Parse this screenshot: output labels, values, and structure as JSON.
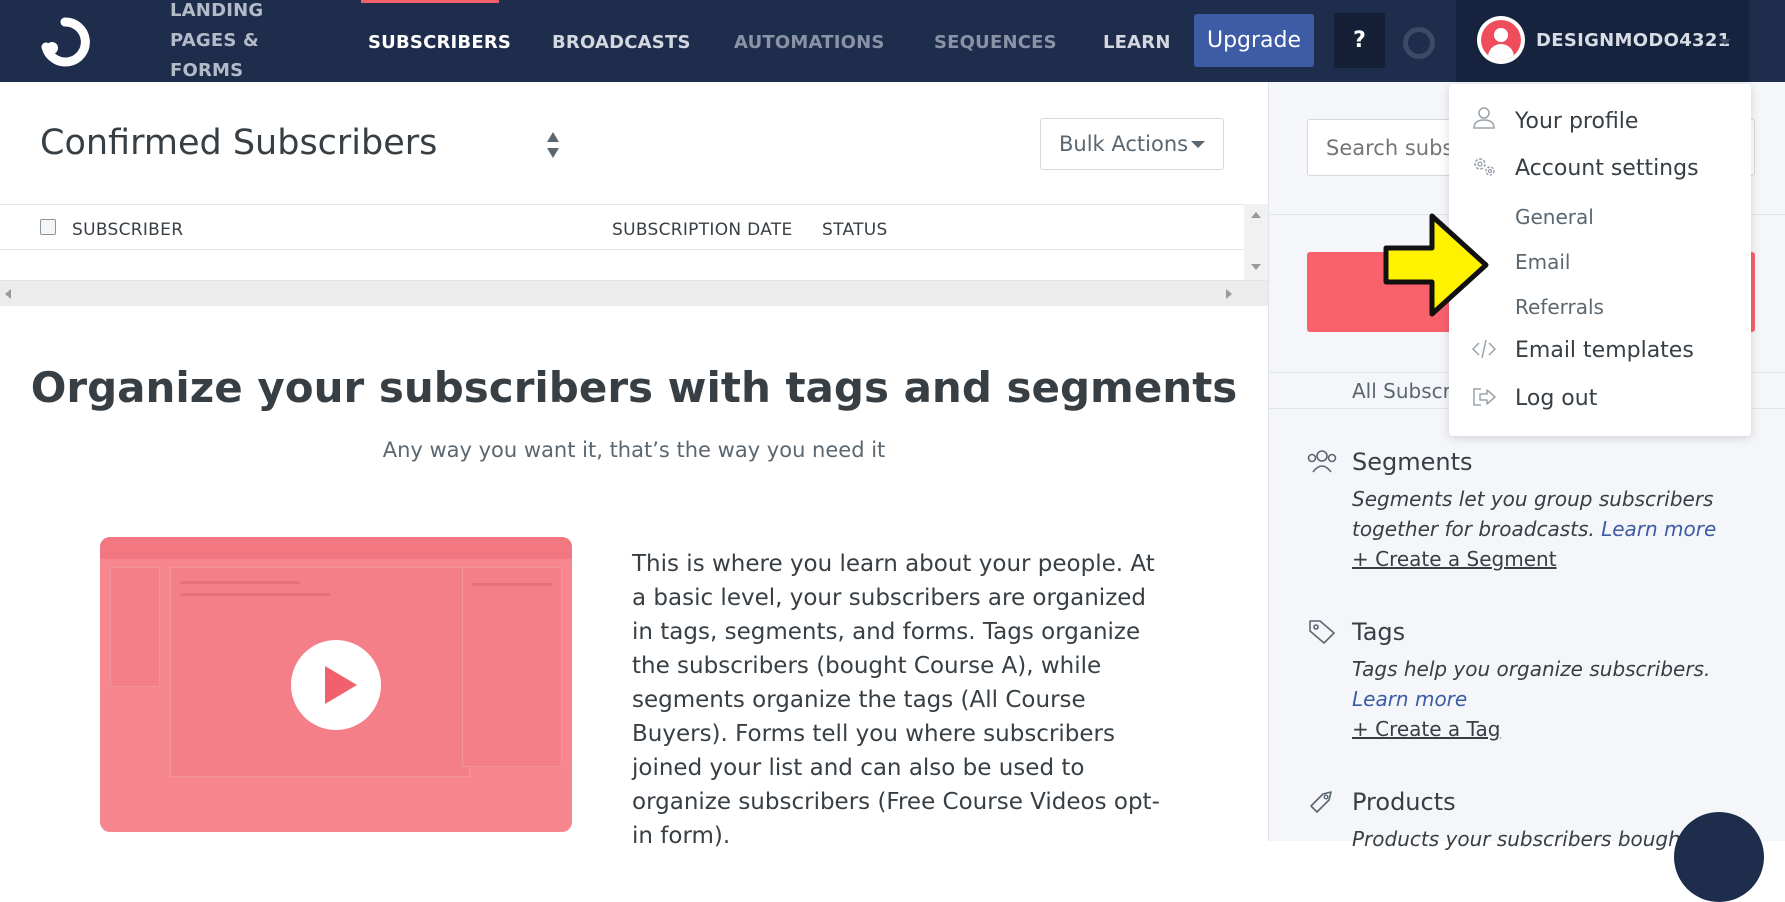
{
  "nav": {
    "items": [
      {
        "label": "LANDING PAGES & FORMS"
      },
      {
        "label": "SUBSCRIBERS"
      },
      {
        "label": "BROADCASTS"
      },
      {
        "label": "AUTOMATIONS"
      },
      {
        "label": "SEQUENCES"
      },
      {
        "label": "LEARN"
      }
    ],
    "upgrade_label": "Upgrade",
    "help_label": "?",
    "username": "DESIGNMODO4321",
    "active_color": "#f0616d",
    "brand_color": "#1f2d4d"
  },
  "main": {
    "title": "Confirmed Subscribers",
    "bulk_actions_label": "Bulk Actions",
    "table_headers": [
      "SUBSCRIBER",
      "SUBSCRIPTION DATE",
      "STATUS"
    ],
    "promo_heading": "Organize your subscribers with tags and segments",
    "promo_subheading": "Any way you want it, that’s the way you need it",
    "promo_body": "This is where you learn about your people. At a basic level, your subscribers are organized in tags, segments, and forms. Tags organize the subscribers (bought Course A), while segments organize the tags (All Course Buyers). Forms tell you where subscribers joined your list and can also be used to organize subscribers (Free Course Videos opt-in form)."
  },
  "sidebar": {
    "search_placeholder": "Search subscribers",
    "all_subscribers_label": "All Subscr",
    "segments": {
      "title": "Segments",
      "desc": "Segments let you group subscribers together for broadcasts.",
      "learn_more": "Learn more",
      "action": "+ Create a Segment"
    },
    "tags": {
      "title": "Tags",
      "desc": "Tags help you organize subscribers.",
      "learn_more": "Learn more",
      "action": "+ Create a Tag"
    },
    "products": {
      "title": "Products",
      "desc": "Products your subscribers bought"
    }
  },
  "dropdown": {
    "your_profile": "Your profile",
    "account_settings": "Account settings",
    "general": "General",
    "email": "Email",
    "referrals": "Referrals",
    "email_templates": "Email templates",
    "log_out": "Log out"
  }
}
